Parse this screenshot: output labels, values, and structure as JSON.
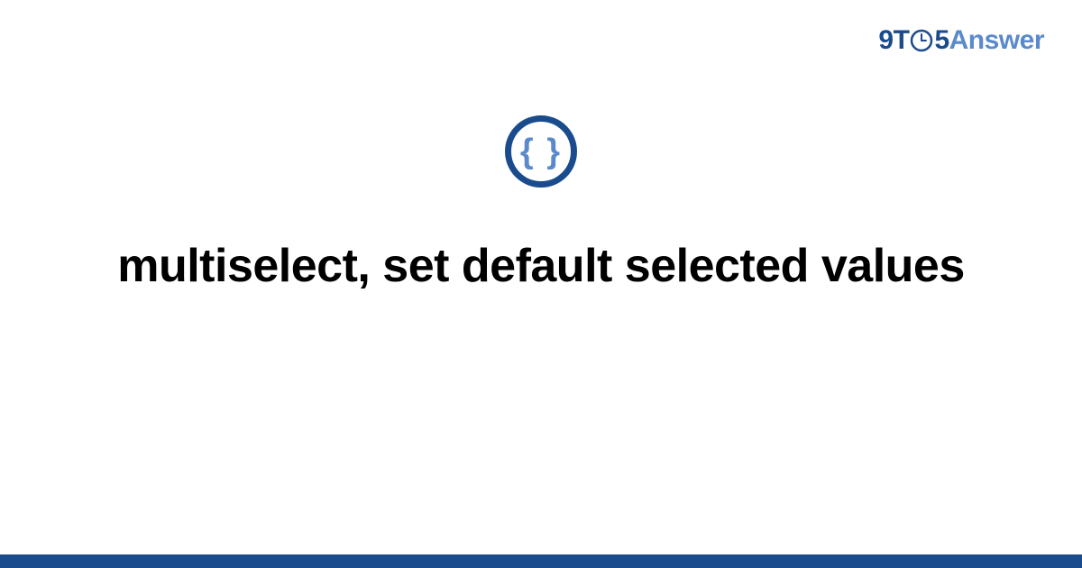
{
  "brand": {
    "part1": "9T",
    "part2": "5",
    "part3": "Answer"
  },
  "icon": {
    "glyph": "{ }"
  },
  "title": "multiselect, set default selected values",
  "colors": {
    "primary": "#1a4b8c",
    "accent": "#5a8acb",
    "background": "#ffffff"
  }
}
